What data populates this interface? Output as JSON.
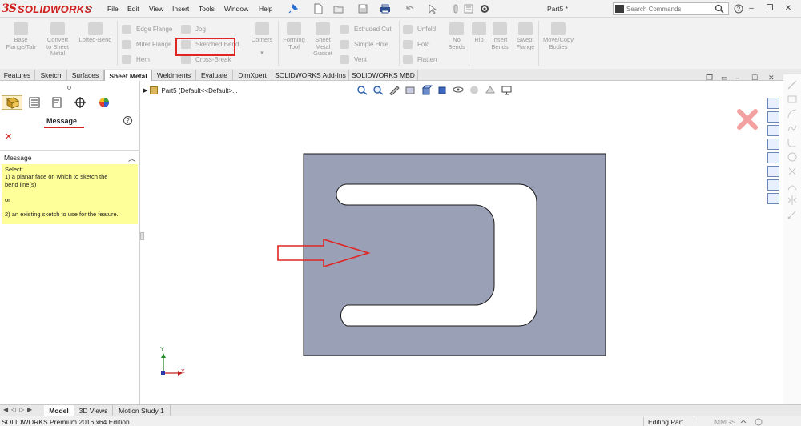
{
  "app": {
    "logo_ds": "3S",
    "logo_name": "SOLIDWORKS",
    "doc_title": "Part5 *",
    "brand_color": "#d02020"
  },
  "menu": [
    "File",
    "Edit",
    "View",
    "Insert",
    "Tools",
    "Window",
    "Help"
  ],
  "search": {
    "placeholder": "Search Commands"
  },
  "ribbon": {
    "big_buttons": [
      {
        "label_lines": [
          "Base",
          "Flange/Tab"
        ],
        "icon": "base-flange-icon"
      },
      {
        "label_lines": [
          "Convert",
          "to Sheet",
          "Metal"
        ],
        "icon": "convert-sheet-metal-icon"
      },
      {
        "label_lines": [
          "Lofted-Bend"
        ],
        "icon": "lofted-bend-icon"
      },
      {
        "label_lines": [
          "Corners"
        ],
        "icon": "corners-icon"
      },
      {
        "label_lines": [
          "Forming",
          "Tool"
        ],
        "icon": "forming-tool-icon"
      },
      {
        "label_lines": [
          "Sheet",
          "Metal",
          "Gusset"
        ],
        "icon": "sheet-metal-gusset-icon"
      },
      {
        "label_lines": [
          "No",
          "Bends"
        ],
        "icon": "no-bends-icon"
      },
      {
        "label_lines": [
          "Rip"
        ],
        "icon": "rip-icon"
      },
      {
        "label_lines": [
          "Insert",
          "Bends"
        ],
        "icon": "insert-bends-icon"
      },
      {
        "label_lines": [
          "Swept",
          "Flange"
        ],
        "icon": "swept-flange-icon"
      },
      {
        "label_lines": [
          "Move/Copy",
          "Bodies"
        ],
        "icon": "move-copy-bodies-icon"
      }
    ],
    "small_buttons": {
      "col1": [
        "Edge Flange",
        "Miter Flange",
        "Hem"
      ],
      "col2": [
        "Jog",
        "Sketched Bend",
        "Cross-Break"
      ],
      "col3": [
        "Extruded Cut",
        "Simple Hole",
        "Vent"
      ],
      "col4": [
        "Unfold",
        "Fold",
        "Flatten"
      ]
    },
    "highlight_color": "#e02525"
  },
  "tabs": [
    "Features",
    "Sketch",
    "Surfaces",
    "Sheet Metal",
    "Weldments",
    "Evaluate",
    "DimXpert",
    "SOLIDWORKS Add-Ins",
    "SOLIDWORKS MBD"
  ],
  "active_tab": "Sheet Metal",
  "property_manager": {
    "title": "Message",
    "help": "?",
    "section": "Message",
    "message_lines": [
      "Select:",
      "1) a planar face on which to sketch the",
      "bend line(s)",
      "",
      "or",
      "",
      "2) an existing sketch to use for the feature."
    ],
    "message_bg": "#ffff99"
  },
  "tree": {
    "item": "Part5  (Default<<Default>..."
  },
  "triad": {
    "x": "X",
    "y": "Y"
  },
  "bottom_tabs": [
    "Model",
    "3D Views",
    "Motion Study 1"
  ],
  "status": {
    "left": "SOLIDWORKS Premium 2016 x64 Edition",
    "mode": "Editing Part",
    "units": "MMGS"
  },
  "part": {
    "fill": "#9aa0b6",
    "arrow_color": "#e02525"
  }
}
